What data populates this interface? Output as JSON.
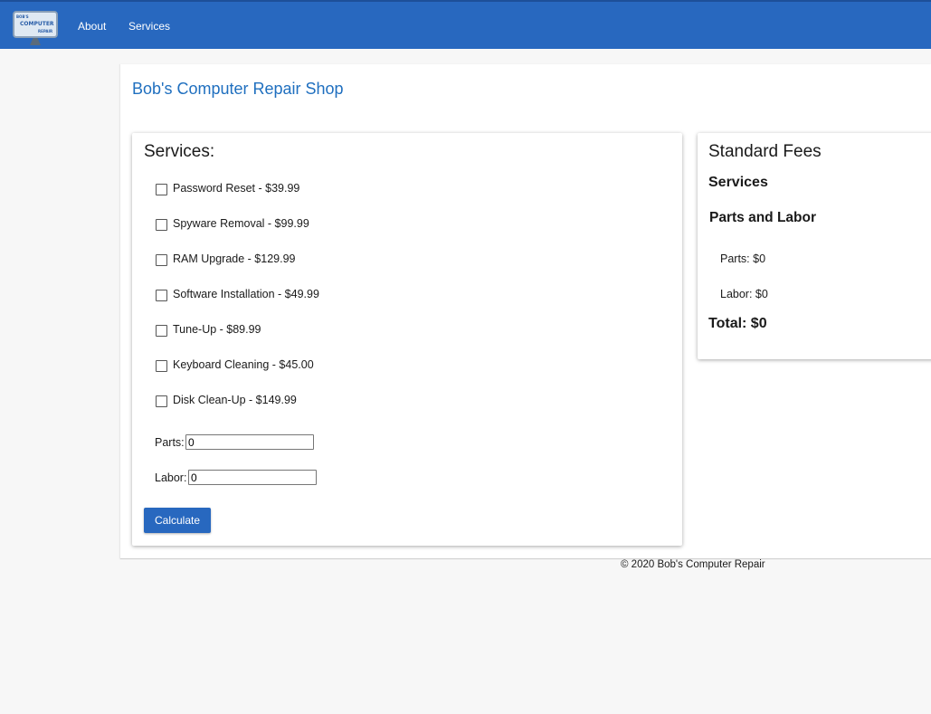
{
  "header": {
    "logo": {
      "line1": "BOB'S",
      "line2": "COMPUTER",
      "line3": "REPAIR"
    },
    "nav": [
      {
        "label": "About"
      },
      {
        "label": "Services"
      }
    ]
  },
  "page": {
    "title": "Bob's Computer Repair Shop"
  },
  "services_card": {
    "heading": "Services:",
    "items": [
      {
        "label": "Password Reset - $39.99",
        "checked": false
      },
      {
        "label": "Spyware Removal - $99.99",
        "checked": false
      },
      {
        "label": "RAM Upgrade - $129.99",
        "checked": false
      },
      {
        "label": "Software Installation - $49.99",
        "checked": false
      },
      {
        "label": "Tune-Up - $89.99",
        "checked": false
      },
      {
        "label": "Keyboard Cleaning - $45.00",
        "checked": false
      },
      {
        "label": "Disk Clean-Up - $149.99",
        "checked": false
      }
    ],
    "parts_label": "Parts:",
    "parts_value": "0",
    "labor_label": "Labor:",
    "labor_value": "0",
    "calculate_label": "Calculate"
  },
  "fees_card": {
    "heading": "Standard Fees",
    "services_heading": "Services",
    "parts_labor_heading": "Parts and Labor",
    "parts_line": "Parts: $0",
    "labor_line": "Labor: $0",
    "total_line": "Total: $0"
  },
  "footer": {
    "copyright": "© 2020 Bob's Computer Repair"
  },
  "colors": {
    "header_bg": "#2868bf",
    "title_blue": "#1f6fbf",
    "button_bg": "#2868bf"
  }
}
